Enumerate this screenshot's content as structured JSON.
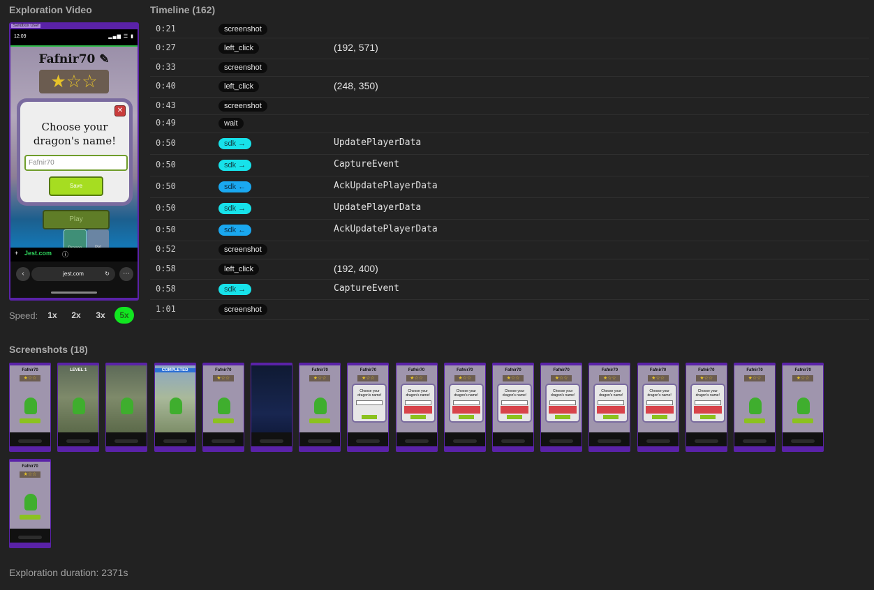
{
  "headings": {
    "video": "Exploration Video",
    "timeline": "Timeline (162)",
    "screenshots": "Screenshots (18)"
  },
  "video": {
    "sandbox_label": "Sandbox User",
    "status_time": "12:09",
    "status_icons": "▂▄▆ ☰ ▮",
    "player_name": "Fafnir70 ✎",
    "stars": "★☆☆",
    "modal_title": "Choose your dragon's name!",
    "name_field_value": "Fafnir70",
    "save_label": "Save",
    "play_label": "Play",
    "dragon_1_label": "Dragon",
    "dragon_2_label": "Pet",
    "jest_logo": "Jest.com",
    "browser_url": "jest.com",
    "back_icon": "‹",
    "reload_icon": "↻",
    "more_icon": "⋯",
    "close_icon": "✕"
  },
  "speed": {
    "label": "Speed:",
    "options": [
      "1x",
      "2x",
      "3x",
      "5x"
    ],
    "active": "5x",
    "active_color": "#11e620"
  },
  "timeline": [
    {
      "time": "0:21",
      "type": "screenshot",
      "style": "dark",
      "detail": "",
      "mono": false
    },
    {
      "time": "0:27",
      "type": "left_click",
      "style": "dark",
      "detail": "(192, 571)",
      "mono": false
    },
    {
      "time": "0:33",
      "type": "screenshot",
      "style": "dark",
      "detail": "",
      "mono": false
    },
    {
      "time": "0:40",
      "type": "left_click",
      "style": "dark",
      "detail": "(248, 350)",
      "mono": false
    },
    {
      "time": "0:43",
      "type": "screenshot",
      "style": "dark",
      "detail": "",
      "mono": false
    },
    {
      "time": "0:49",
      "type": "wait",
      "style": "dark",
      "detail": "",
      "mono": false
    },
    {
      "time": "0:50",
      "type": "sdk →",
      "style": "cyan",
      "detail": "UpdatePlayerData",
      "mono": true
    },
    {
      "time": "0:50",
      "type": "sdk →",
      "style": "cyan",
      "detail": "CaptureEvent",
      "mono": true
    },
    {
      "time": "0:50",
      "type": "sdk ←",
      "style": "blue",
      "detail": "AckUpdatePlayerData",
      "mono": true
    },
    {
      "time": "0:50",
      "type": "sdk →",
      "style": "cyan",
      "detail": "UpdatePlayerData",
      "mono": true
    },
    {
      "time": "0:50",
      "type": "sdk ←",
      "style": "blue",
      "detail": "AckUpdatePlayerData",
      "mono": true
    },
    {
      "time": "0:52",
      "type": "screenshot",
      "style": "dark",
      "detail": "",
      "mono": false
    },
    {
      "time": "0:58",
      "type": "left_click",
      "style": "dark",
      "detail": "(192, 400)",
      "mono": false
    },
    {
      "time": "0:58",
      "type": "sdk →",
      "style": "cyan",
      "detail": "CaptureEvent",
      "mono": true
    },
    {
      "time": "1:01",
      "type": "screenshot",
      "style": "dark",
      "detail": "",
      "mono": false
    }
  ],
  "screenshots": [
    {
      "kind": "home",
      "title": "Fafnir70"
    },
    {
      "kind": "level",
      "title": "LEVEL 1"
    },
    {
      "kind": "level",
      "title": ""
    },
    {
      "kind": "completed",
      "title": "COMPLETED"
    },
    {
      "kind": "home",
      "title": "Fafnir70"
    },
    {
      "kind": "dark",
      "title": ""
    },
    {
      "kind": "home",
      "title": "Fafnir70"
    },
    {
      "kind": "modal",
      "title": "Fafnir70"
    },
    {
      "kind": "modal-error",
      "title": "Fafnir70"
    },
    {
      "kind": "modal-error",
      "title": "Fafnir70"
    },
    {
      "kind": "modal-error",
      "title": "Fafnir70"
    },
    {
      "kind": "modal-error",
      "title": "Fafnir70"
    },
    {
      "kind": "modal-error",
      "title": "Fafnir70"
    },
    {
      "kind": "modal-error",
      "title": "Fafnir70"
    },
    {
      "kind": "modal-error",
      "title": "Fafnir70"
    },
    {
      "kind": "home",
      "title": "Fafnir70"
    },
    {
      "kind": "home",
      "title": "Fafnir70"
    },
    {
      "kind": "home",
      "title": "Fafnir70"
    }
  ],
  "footer": {
    "duration": "Exploration duration: 2371s"
  }
}
